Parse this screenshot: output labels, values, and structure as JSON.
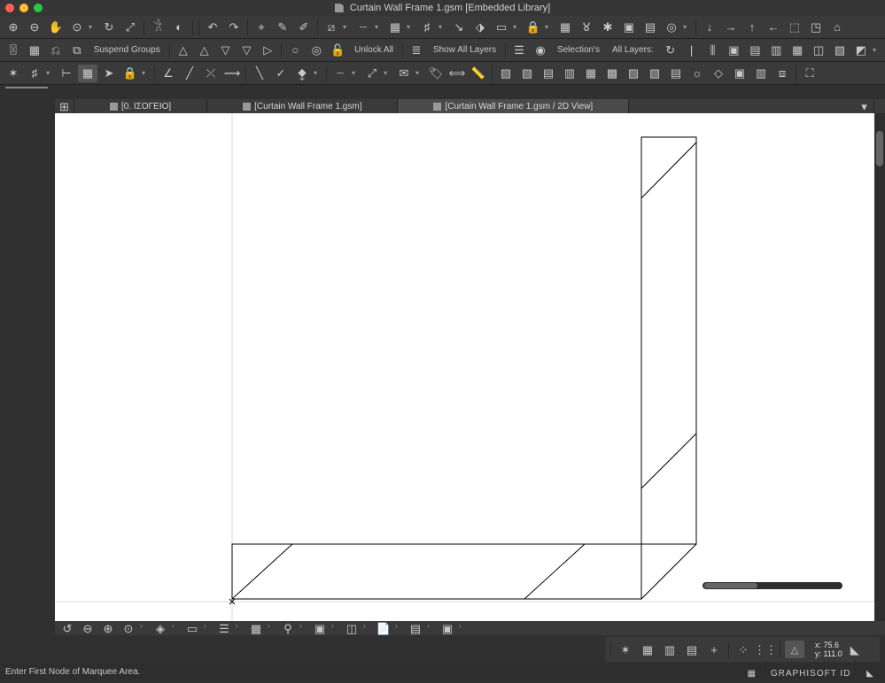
{
  "title": "Curtain Wall Frame 1.gsm [Embedded Library]",
  "tabs": [
    {
      "label": "[0. ΙΣΟΓΕΙΟ]"
    },
    {
      "label": "[Curtain Wall Frame 1.gsm]"
    },
    {
      "label": "[Curtain Wall Frame 1.gsm / 2D View]"
    }
  ],
  "toolbar2": {
    "suspend_groups": "Suspend Groups",
    "unlock_all": "Unlock All",
    "show_all_layers": "Show All Layers",
    "selections": "Selection's",
    "all_layers": "All Layers:"
  },
  "coords": {
    "x_label": "x:",
    "y_label": "y:",
    "x": "75.6",
    "y": "111.0"
  },
  "status": {
    "prompt": "Enter First Node of Marquee Area.",
    "brand": "GRAPHISOFT ID"
  }
}
